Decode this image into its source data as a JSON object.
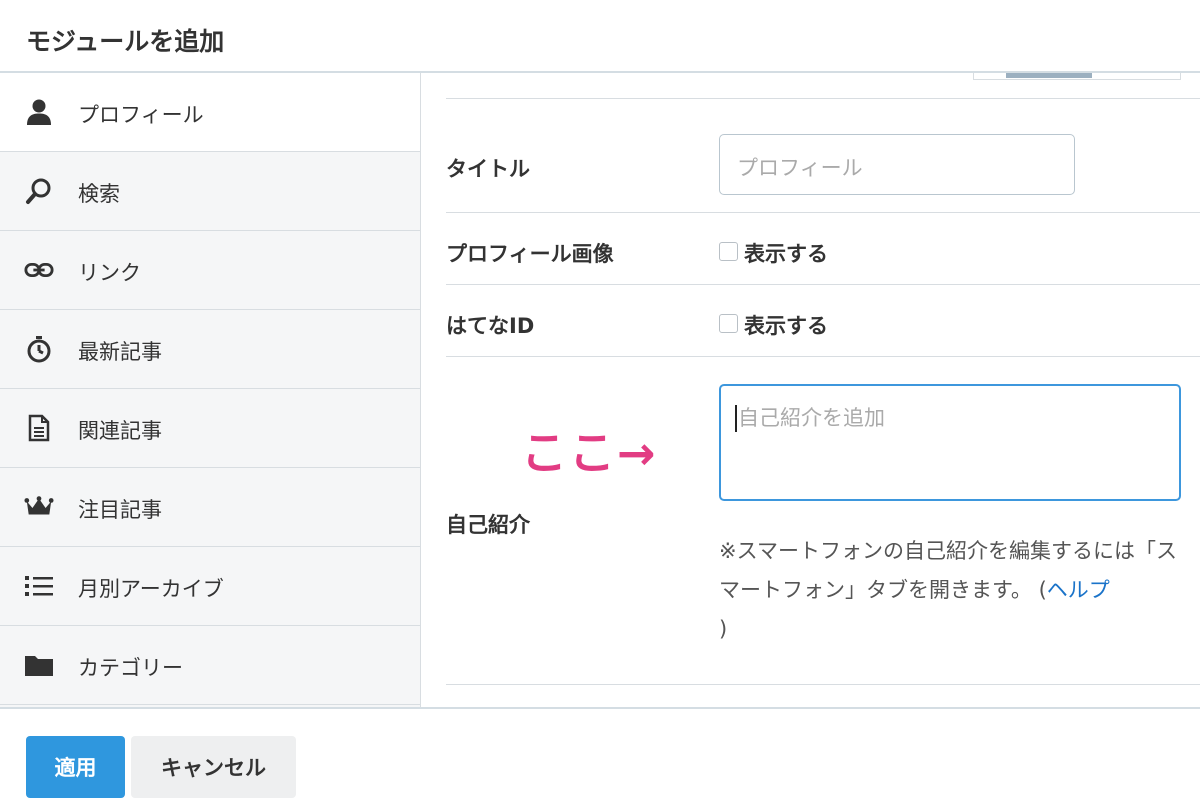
{
  "dialog": {
    "title": "モジュールを追加"
  },
  "sidebar": {
    "items": [
      {
        "label": "プロフィール",
        "icon": "user-icon",
        "active": true
      },
      {
        "label": "検索",
        "icon": "search-icon"
      },
      {
        "label": "リンク",
        "icon": "link-icon"
      },
      {
        "label": "最新記事",
        "icon": "stopwatch-icon"
      },
      {
        "label": "関連記事",
        "icon": "document-icon"
      },
      {
        "label": "注目記事",
        "icon": "crown-icon"
      },
      {
        "label": "月別アーカイブ",
        "icon": "list-icon"
      },
      {
        "label": "カテゴリー",
        "icon": "folder-icon"
      }
    ]
  },
  "form": {
    "title_label": "タイトル",
    "title_placeholder": "プロフィール",
    "profile_image_label": "プロフィール画像",
    "profile_image_option": "表示する",
    "hatena_id_label": "はてなID",
    "hatena_id_option": "表示する",
    "bio_label": "自己紹介",
    "bio_placeholder": "自己紹介を追加",
    "bio_note_1": "※スマートフォンの自己紹介を編集するには「スマートフォン」タブを開きます。 (",
    "bio_note_help": "ヘルプ",
    "bio_note_2": ")"
  },
  "annotation": {
    "text": "ここ→"
  },
  "footer": {
    "apply_label": "適用",
    "cancel_label": "キャンセル"
  },
  "colors": {
    "primary": "#2f97de",
    "annotation": "#e23c83",
    "link": "#1a73c9",
    "sidebar_bg": "#f5f6f7"
  }
}
